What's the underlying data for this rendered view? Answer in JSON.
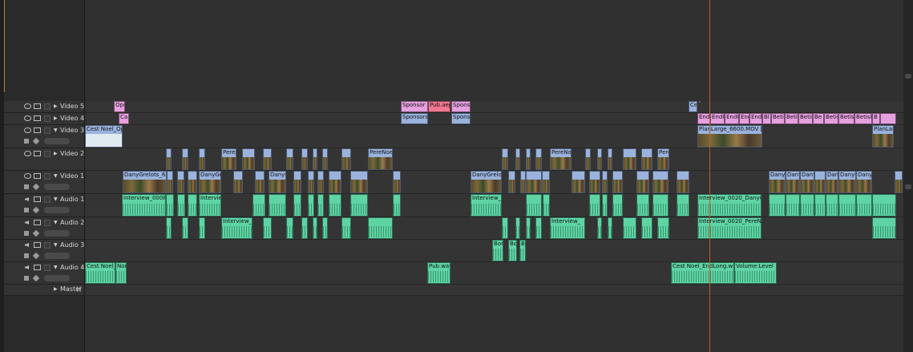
{
  "tracks": [
    {
      "name": "Video 5",
      "kind": "video"
    },
    {
      "name": "Video 4",
      "kind": "video"
    },
    {
      "name": "Video 3",
      "kind": "video"
    },
    {
      "name": "Video 2",
      "kind": "video"
    },
    {
      "name": "Video 1",
      "kind": "video"
    },
    {
      "name": "Audio 1",
      "kind": "audio"
    },
    {
      "name": "Audio 2",
      "kind": "audio"
    },
    {
      "name": "Audio 3",
      "kind": "audio"
    },
    {
      "name": "Audio 4",
      "kind": "audio"
    },
    {
      "name": "Master",
      "kind": "master"
    }
  ],
  "clip_labels": {
    "v5": [
      "Ope",
      "Sponsor",
      "Pub.aep",
      "Sponso",
      "Ce",
      "End",
      "EndC",
      "EndC",
      "End",
      "EndC",
      "Bl",
      "Betisi",
      "Betisi",
      "Betisi",
      "Be",
      "Betisi",
      "Betisi",
      "Betisie",
      "B"
    ],
    "v4": [
      "Ca",
      "Sponsors",
      "Sponso"
    ],
    "v3": [
      "Cest Noel_Op",
      "PlanLarge_6600.MOV [V]",
      "PlanLar"
    ],
    "v2": [
      "PereN",
      "PereNoe",
      "PereNo",
      "PereN"
    ],
    "v1": [
      "DanyGrelots_65",
      "DanyGr",
      "DanyGr",
      "DanyGrelot",
      "Danyl",
      "Danyl",
      "Danyl",
      "Danyl",
      "DanyG",
      "Danyl"
    ],
    "a1": [
      "Interview_0008_",
      "Interview_",
      "Interview_",
      "Interview_0020_DanyGrel"
    ],
    "a2": [
      "Interview_C",
      "Interview_",
      "Interview_0020_PereNoe"
    ],
    "a3": [
      "Bor",
      "Bo",
      "B"
    ],
    "a4": [
      "Cest Noel_",
      "Nor",
      "Pub.wav",
      "Cest Noel_EndLong.wav",
      "Volume:Level"
    ]
  },
  "colors": {
    "pink": "#e6a0e0",
    "red": "#f07890",
    "blue": "#9ab3dd",
    "audio": "#5ed4a4",
    "playhead": "#c05a20"
  }
}
